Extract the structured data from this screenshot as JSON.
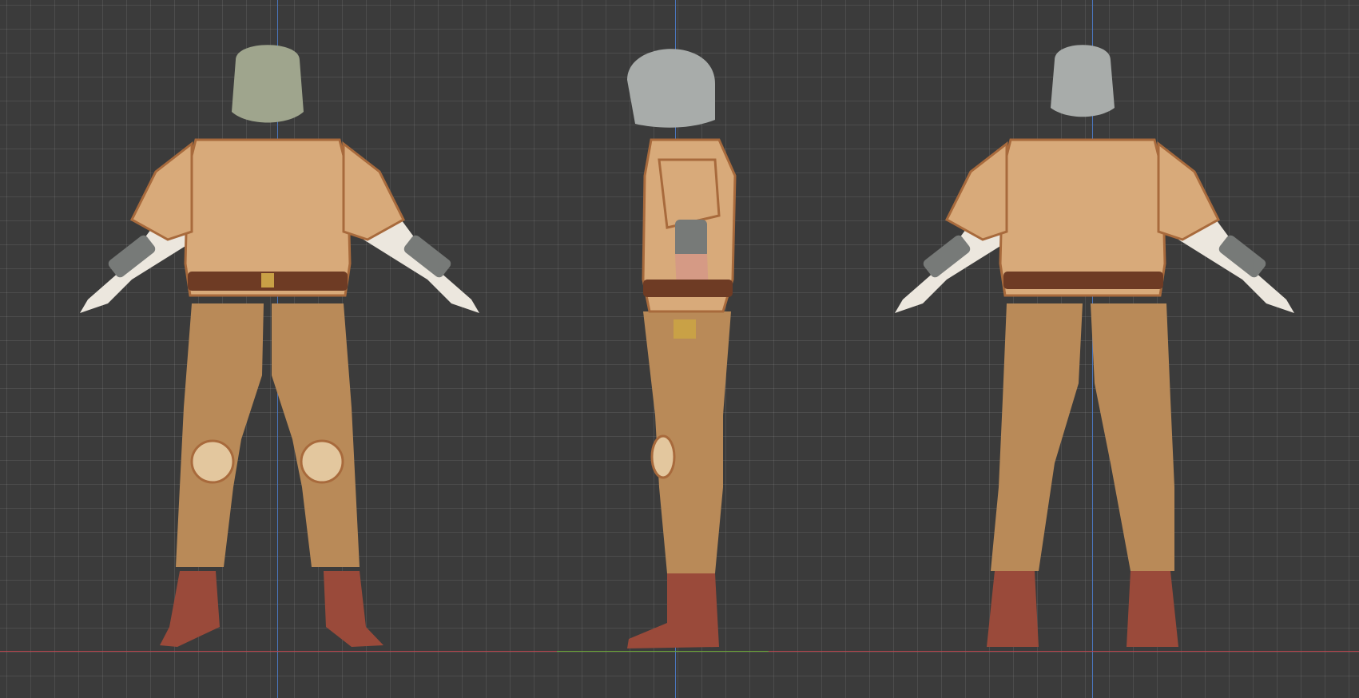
{
  "viewport": {
    "background_color": "#3b3b3b",
    "axis_colors": {
      "x_axis": "#b5434a",
      "y_axis": "#6aa535",
      "z_axis": "#4b76bd"
    }
  },
  "character": {
    "views": [
      "front-view",
      "side-view",
      "back-view"
    ],
    "colors": {
      "gambeson": "#d8aa7a",
      "gambeson_trim": "#a86a3c",
      "trousers": "#b98a58",
      "boots": "#9a4a3a",
      "belt": "#6e3b24",
      "helmet_steel": "#a8acaa",
      "helmet_visor": "#9fa58d",
      "skin": "#d59a85",
      "shirt": "#ece7de",
      "bracer": "#777a78"
    }
  }
}
